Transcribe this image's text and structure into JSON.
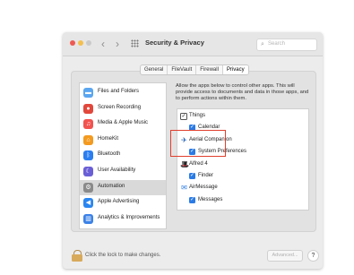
{
  "window": {
    "title": "Security & Privacy",
    "back": "‹",
    "forward": "›",
    "search_placeholder": "Search",
    "search_icon": "magnifier-icon"
  },
  "tabs": [
    {
      "label": "General",
      "active": false
    },
    {
      "label": "FileVault",
      "active": false
    },
    {
      "label": "Firewall",
      "active": false
    },
    {
      "label": "Privacy",
      "active": true
    }
  ],
  "sidebar": {
    "selected_index": 6,
    "items": [
      {
        "label": "Files and Folders",
        "icon": "folder-icon",
        "color": "#5aa6f0"
      },
      {
        "label": "Screen Recording",
        "icon": "record-icon",
        "color": "#e2473b"
      },
      {
        "label": "Media & Apple Music",
        "icon": "music-icon",
        "color": "#f2534f"
      },
      {
        "label": "HomeKit",
        "icon": "home-icon",
        "color": "#f39a1f"
      },
      {
        "label": "Bluetooth",
        "icon": "bluetooth-icon",
        "color": "#2a7ef0"
      },
      {
        "label": "User Availability",
        "icon": "moon-icon",
        "color": "#6b5fd6"
      },
      {
        "label": "Automation",
        "icon": "gear-icon",
        "color": "#8a8a8a"
      },
      {
        "label": "Apple Advertising",
        "icon": "megaphone-icon",
        "color": "#2a86f0"
      },
      {
        "label": "Analytics & Improvements",
        "icon": "chart-icon",
        "color": "#3b82e8"
      }
    ]
  },
  "description": "Allow the apps below to control other apps. This will provide access to documents and data in those apps, and to perform actions within them.",
  "apps": [
    {
      "label": "Things",
      "kind": "checkbox-outline",
      "checked": true,
      "indent": false
    },
    {
      "label": "Calendar",
      "kind": "checkbox",
      "checked": true,
      "indent": true
    },
    {
      "label": "Aerial Companion",
      "kind": "app",
      "icon": "aerial-companion-icon",
      "indent": false
    },
    {
      "label": "System Preferences",
      "kind": "checkbox",
      "checked": true,
      "indent": true
    },
    {
      "label": "Alfred 4",
      "kind": "app",
      "icon": "alfred-icon",
      "indent": false
    },
    {
      "label": "Finder",
      "kind": "checkbox",
      "checked": true,
      "indent": true
    },
    {
      "label": "AirMessage",
      "kind": "app",
      "icon": "airmessage-icon",
      "indent": false
    },
    {
      "label": "Messages",
      "kind": "checkbox",
      "checked": true,
      "indent": true
    }
  ],
  "bottom": {
    "lock_text": "Click the lock to make changes.",
    "advanced_label": "Advanced...",
    "help_label": "?"
  },
  "colors": {
    "accent": "#2b7be5",
    "highlight_border": "#e0402e"
  }
}
